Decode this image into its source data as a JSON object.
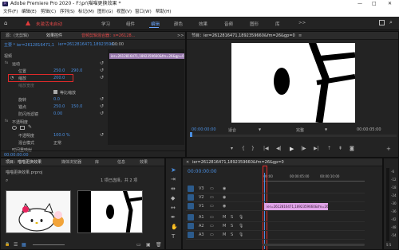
{
  "app": {
    "title": "Adobe Premiere Pro 2020 - F:\\pr\\喵喵更换效果 *",
    "win_minimize": "—",
    "win_maximize": "□",
    "win_close": "✕"
  },
  "menu": [
    "文件(F)",
    "编辑(E)",
    "剪辑(C)",
    "序列(S)",
    "标记(M)",
    "图形(G)",
    "视图(V)",
    "窗口(W)",
    "帮助(H)"
  ],
  "workspace": {
    "warning_text": "未激活未启动",
    "tabs": [
      "学习",
      "组件",
      "编辑",
      "颜色",
      "效果",
      "音频",
      "图形",
      "库"
    ],
    "active_tab": "编辑",
    "more": ">>"
  },
  "effect_controls": {
    "tabs": [
      "源：(无剪辑)",
      "效果控件",
      "音频剪辑混合器：s=26128...",
      ">>"
    ],
    "main_label": "主要 * ier=2612816471,1",
    "clip_ref": "ier=2612816471,18923596...",
    "timecode_clip": ":00:00",
    "clip_bar_label": "ier=2612816471,1892359660&fm=26&gp=0",
    "section_video": "视频",
    "motion": "运动",
    "position_label": "位置",
    "position_x": "250.0",
    "position_y": "290.0",
    "scale_label": "缩放",
    "scale_value": "200.0",
    "scale_width_label": "缩放宽度",
    "uniform_scale_label": "等比缩放",
    "rotation_label": "旋转",
    "rotation_value": "0.0",
    "anchor_label": "锚点",
    "anchor_x": "250.0",
    "anchor_y": "150.0",
    "antiflicker_label": "防闪烁滤镜",
    "antiflicker_value": "0.00",
    "opacity_label": "不透明度",
    "opacity_sub_label": "不透明度",
    "opacity_value": "100.0 %",
    "blend_label": "混合模式",
    "blend_value": "正常",
    "time_remap_label": "时间重映射",
    "footer_time": "00:00:00:00"
  },
  "program_monitor": {
    "tab": "节目：ier=2612816471,1892359660&fm=26&gp=0",
    "menu": "≡",
    "timecode": "00:00:00:00",
    "fit": "适合",
    "quality": "完整",
    "duration": "00:00:05:00"
  },
  "project": {
    "tabs": [
      "项目：喵喵更换效果",
      "媒体浏览器",
      "库",
      "信息",
      "效果",
      "标记",
      "历史记录",
      ">>"
    ],
    "file": "喵喵更换效果.prproj",
    "item_count": "1 项已选择，共 2 项"
  },
  "timeline": {
    "tab": "ier=2612816471,1892359660&fm=26&gp=0",
    "timecode": "00:00:00:00",
    "ruler_start": ":00:00",
    "ruler_mid": "00:00:05:00",
    "ruler_end": "00:00:10:00",
    "tracks": [
      "V3",
      "V2",
      "V1",
      "A1",
      "A2",
      "A3"
    ],
    "clip_label": "ier=2612816471,1892359660&fm=26&gp=0",
    "meter_labels": [
      "-6",
      "-12",
      "-18",
      "-24",
      "-30",
      "-36",
      "-42",
      "-48",
      "-54"
    ],
    "meter_footer": "S S"
  },
  "tools": [
    "selection",
    "track-select",
    "ripple-edit",
    "razor",
    "slip",
    "pen",
    "hand",
    "type"
  ]
}
